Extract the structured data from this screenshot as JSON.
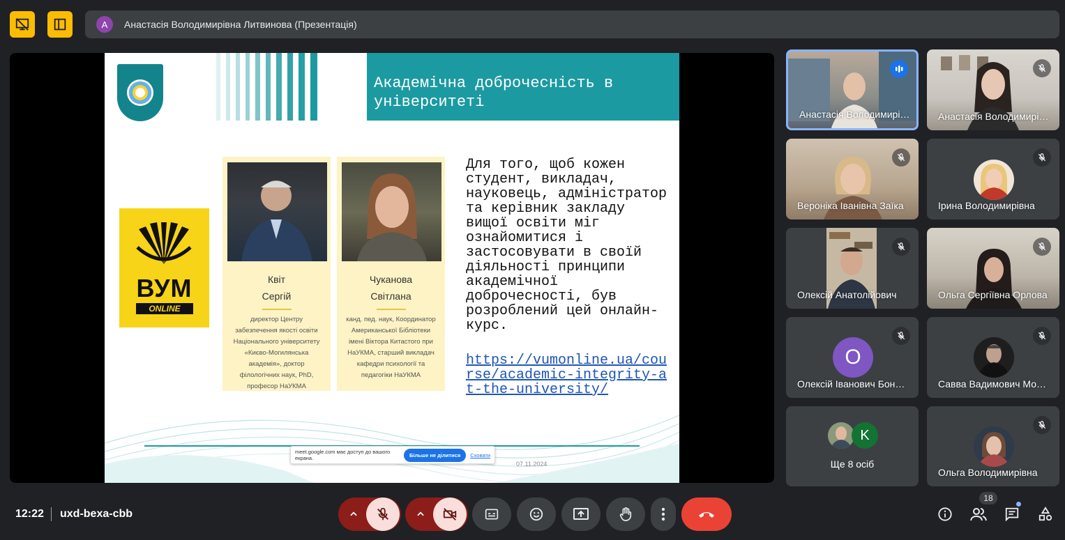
{
  "presenter": {
    "avatar_letter": "A",
    "title": "Анастасія Володимирівна Литвинова (Презентація)"
  },
  "slide": {
    "title": "Академічна доброчесність в університеті",
    "logo": {
      "word": "ВУМ",
      "sub": "ONLINE"
    },
    "people": [
      {
        "name1": "Квіт",
        "name2": "Сергій",
        "desc": "директор Центру забезпечення якості освіти Національного університету «Києво-Могилянська академія», доктор філологічних наук, PhD, професор НаУКМА"
      },
      {
        "name1": "Чуканова",
        "name2": "Світлана",
        "desc": "канд. пед. наук, Координатор Американської Бібліотеки імені Віктора Китастого при НаУКМА, старший викладач кафедри психології та педагогіки НаУКМА"
      }
    ],
    "body": "Для того, щоб кожен студент, викладач, науковець, адміністратор та керівник закладу вищої освіти міг ознайомитися і застосовувати в своїй діяльності принципи академічної доброчесності, був розроблений цей онлайн-курс.",
    "link": "https://vumonline.ua/course/academic-integrity-at-the-university/",
    "date": "07.11.2024",
    "share_banner": {
      "message": "meet.google.com має доступ до вашого екрана.",
      "stop_label": "Більше не ділитися",
      "hide_label": "Сховати"
    }
  },
  "participants": [
    {
      "name": "Анастасія Володимирівна Литвинова",
      "speaking": true
    },
    {
      "name": "Анастасія Володимирівна",
      "muted": true
    },
    {
      "name": "Вероніка Іванівна Заїка",
      "muted": true
    },
    {
      "name": "Ірина Володимирівна",
      "muted": true
    },
    {
      "name": "Олексій Анатолійович",
      "muted": true
    },
    {
      "name": "Ольга Сергіївна Орлова",
      "muted": true
    },
    {
      "name": "Олексій Іванович Бондар",
      "muted": true,
      "initial": "О"
    },
    {
      "name": "Савва Вадимович Мороз",
      "muted": true
    },
    {
      "name": "Ольга Володимирівна",
      "muted": true
    }
  ],
  "others": {
    "label": "Ще 8 осіб",
    "initial": "K"
  },
  "bottom": {
    "time": "12:22",
    "meeting_code": "uxd-bexa-cbb",
    "people_count": "18"
  },
  "colors": {
    "accent": "#8ab4f8",
    "end_call": "#ea4335",
    "highlight": "#fbbc04",
    "slide_teal": "#1c9aa1"
  }
}
